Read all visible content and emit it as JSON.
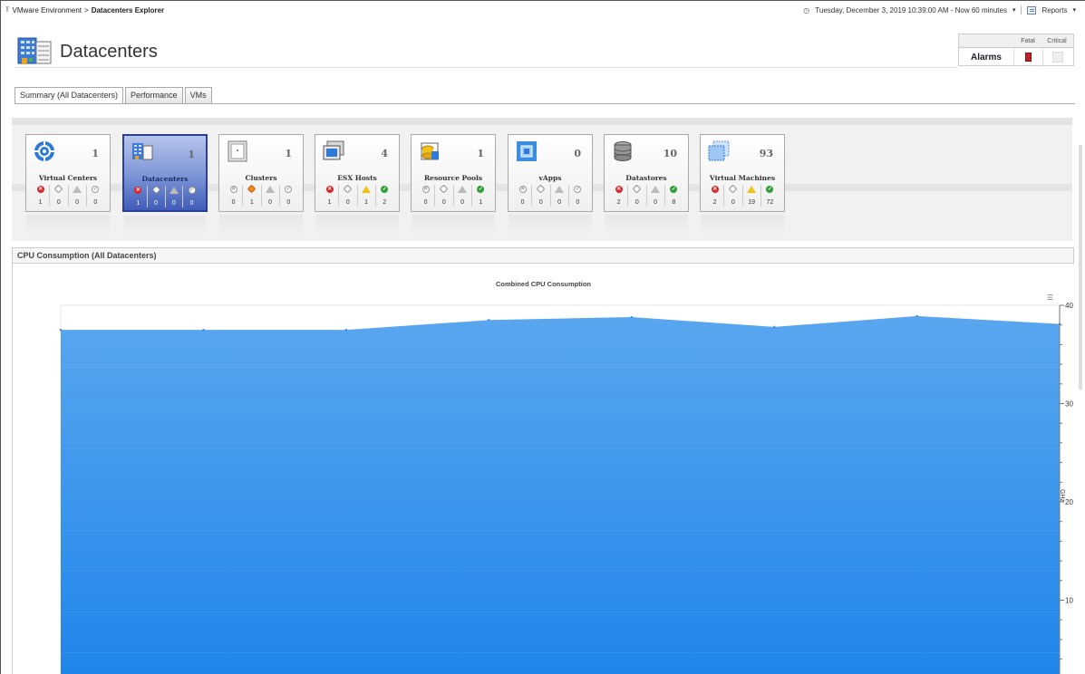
{
  "breadcrumb": {
    "parent": "VMware Environment",
    "current": "Datacenters Explorer"
  },
  "time_range": "Tuesday, December 3, 2019 10:39:00 AM - Now 60 minutes",
  "reports_label": "Reports",
  "page_title": "Datacenters",
  "alarms": {
    "label": "Alarms",
    "col_fatal": "Fatal",
    "col_critical": "Critical"
  },
  "tabs": [
    "Summary (All Datacenters)",
    "Performance",
    "VMs"
  ],
  "tiles": [
    {
      "name": "Virtual Centers",
      "count": "1",
      "icon": "virtual-center-icon",
      "states": [
        "1",
        "0",
        "0",
        "0"
      ]
    },
    {
      "name": "Datacenters",
      "count": "1",
      "icon": "datacenter-icon",
      "states": [
        "1",
        "0",
        "0",
        "0"
      ]
    },
    {
      "name": "Clusters",
      "count": "1",
      "icon": "cluster-icon",
      "states": [
        "0",
        "1",
        "0",
        "0"
      ]
    },
    {
      "name": "ESX Hosts",
      "count": "4",
      "icon": "esx-host-icon",
      "states": [
        "1",
        "0",
        "1",
        "2"
      ]
    },
    {
      "name": "Resource Pools",
      "count": "1",
      "icon": "resource-pool-icon",
      "states": [
        "0",
        "0",
        "0",
        "1"
      ]
    },
    {
      "name": "vApps",
      "count": "0",
      "icon": "vapp-icon",
      "states": [
        "0",
        "0",
        "0",
        "0"
      ]
    },
    {
      "name": "Datastores",
      "count": "10",
      "icon": "datastore-icon",
      "states": [
        "2",
        "0",
        "0",
        "8"
      ]
    },
    {
      "name": "Virtual Machines",
      "count": "93",
      "icon": "virtual-machine-icon",
      "states": [
        "2",
        "0",
        "19",
        "72"
      ]
    }
  ],
  "cpu_section_title": "CPU Consumption (All Datacenters)",
  "colors": {
    "area_top": "#5aa6ef",
    "area_bottom": "#1f86ea",
    "selected_tile": "#3f5cb8",
    "fatal": "#c0202a"
  },
  "chart_data": {
    "type": "area",
    "title": "Combined CPU Consumption",
    "ylabel": "GHz",
    "ylim": [
      0,
      40
    ],
    "yticks": [
      "40",
      "30",
      "20",
      "10"
    ],
    "y_axis_side": "right",
    "series": [
      {
        "values": [
          37.5,
          37.5,
          37.5,
          38.5,
          38.8,
          37.8,
          38.9,
          38.1
        ]
      }
    ]
  }
}
